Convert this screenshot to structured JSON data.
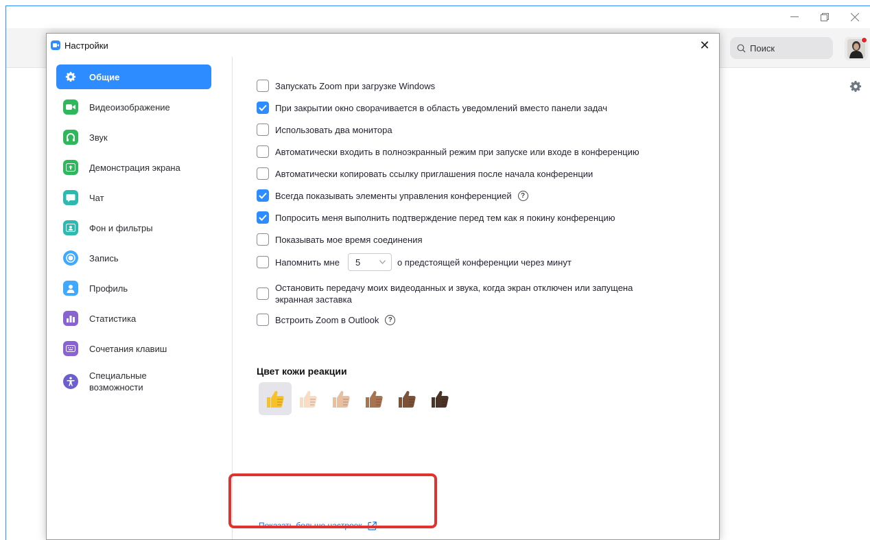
{
  "main_window": {
    "search_placeholder": "Поиск"
  },
  "dialog": {
    "title": "Настройки",
    "close_glyph": "✕"
  },
  "sidebar": {
    "items": [
      {
        "label": "Общие",
        "icon": "gear-icon",
        "color": "#ffffff",
        "active": true
      },
      {
        "label": "Видеоизображение",
        "icon": "video-camera-icon",
        "color": "#2fb85b"
      },
      {
        "label": "Звук",
        "icon": "headphones-icon",
        "color": "#2fb85b"
      },
      {
        "label": "Демонстрация экрана",
        "icon": "share-screen-icon",
        "color": "#2fb85b"
      },
      {
        "label": "Чат",
        "icon": "chat-icon",
        "color": "#2cb9b0"
      },
      {
        "label": "Фон и фильтры",
        "icon": "background-icon",
        "color": "#2cb9b0"
      },
      {
        "label": "Запись",
        "icon": "record-icon",
        "color": "#3fa8ff"
      },
      {
        "label": "Профиль",
        "icon": "profile-icon",
        "color": "#3fa8ff"
      },
      {
        "label": "Статистика",
        "icon": "statistics-icon",
        "color": "#8a63d2"
      },
      {
        "label": "Сочетания клавиш",
        "icon": "keyboard-icon",
        "color": "#8a63d2"
      },
      {
        "label": "Специальные возможности",
        "icon": "accessibility-icon",
        "color": "#6b5fd0"
      }
    ]
  },
  "options": [
    {
      "label": "Запускать Zoom при загрузке Windows",
      "checked": false
    },
    {
      "label": "При закрытии окно сворачивается в область уведомлений вместо панели задач",
      "checked": true
    },
    {
      "label": "Использовать два монитора",
      "checked": false
    },
    {
      "label": "Автоматически входить в полноэкранный режим при запуске или входе в конференцию",
      "checked": false
    },
    {
      "label": "Автоматически копировать ссылку приглашения после начала конференции",
      "checked": false
    },
    {
      "label": "Всегда показывать элементы управления конференцией",
      "checked": true,
      "help": true
    },
    {
      "label": "Попросить меня выполнить подтверждение перед тем как я покину конференцию",
      "checked": true
    },
    {
      "label": "Показывать мое время соединения",
      "checked": false
    }
  ],
  "reminder": {
    "label_before": "Напомнить мне",
    "value": "5",
    "label_after": "о предстоящей конференции через минут",
    "checked": false
  },
  "stop_video": {
    "line1": "Остановить передачу моих видеоданных и звука, когда экран отключен или запущена",
    "line2": "экранная заставка",
    "checked": false
  },
  "outlook": {
    "label": "Встроить Zoom в Outlook",
    "checked": false
  },
  "help_glyph": "?",
  "skin_tone": {
    "title": "Цвет кожи реакции",
    "tones": [
      "#f7c127",
      "#f9dcc4",
      "#e8bfa0",
      "#a9734f",
      "#7d5236",
      "#4b3325"
    ],
    "selected": 0
  },
  "more_settings_link": "Показать больше настроек",
  "colors": {
    "accent": "#2d8cff",
    "link": "#0e72ed",
    "highlight": "#e0322f"
  }
}
